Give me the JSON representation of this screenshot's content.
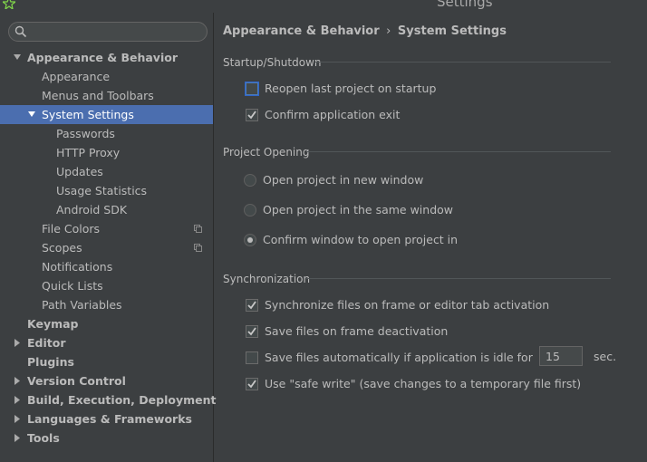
{
  "window": {
    "title": "Settings"
  },
  "search": {
    "placeholder": ""
  },
  "tree": [
    {
      "label": "Appearance & Behavior",
      "level": 0,
      "bold": true,
      "arrow": "down"
    },
    {
      "label": "Appearance",
      "level": 1
    },
    {
      "label": "Menus and Toolbars",
      "level": 1
    },
    {
      "label": "System Settings",
      "level": 1,
      "arrow": "down",
      "selected": true
    },
    {
      "label": "Passwords",
      "level": 2
    },
    {
      "label": "HTTP Proxy",
      "level": 2
    },
    {
      "label": "Updates",
      "level": 2
    },
    {
      "label": "Usage Statistics",
      "level": 2
    },
    {
      "label": "Android SDK",
      "level": 2
    },
    {
      "label": "File Colors",
      "level": 1,
      "copy_icon": true
    },
    {
      "label": "Scopes",
      "level": 1,
      "copy_icon": true
    },
    {
      "label": "Notifications",
      "level": 1
    },
    {
      "label": "Quick Lists",
      "level": 1
    },
    {
      "label": "Path Variables",
      "level": 1
    },
    {
      "label": "Keymap",
      "level": 0,
      "bold": true
    },
    {
      "label": "Editor",
      "level": 0,
      "bold": true,
      "arrow": "right"
    },
    {
      "label": "Plugins",
      "level": 0,
      "bold": true
    },
    {
      "label": "Version Control",
      "level": 0,
      "bold": true,
      "arrow": "right"
    },
    {
      "label": "Build, Execution, Deployment",
      "level": 0,
      "bold": true,
      "arrow": "right"
    },
    {
      "label": "Languages & Frameworks",
      "level": 0,
      "bold": true,
      "arrow": "right"
    },
    {
      "label": "Tools",
      "level": 0,
      "bold": true,
      "arrow": "right"
    }
  ],
  "breadcrumb": {
    "parent": "Appearance & Behavior",
    "separator": "›",
    "current": "System Settings"
  },
  "startup": {
    "title": "Startup/Shutdown",
    "reopen": {
      "label": "Reopen last project on startup",
      "checked": false
    },
    "confirm_exit": {
      "label": "Confirm application exit",
      "checked": true
    }
  },
  "opening": {
    "title": "Project Opening",
    "options": [
      {
        "label": "Open project in new window",
        "selected": false
      },
      {
        "label": "Open project in the same window",
        "selected": false
      },
      {
        "label": "Confirm window to open project in",
        "selected": true
      }
    ]
  },
  "sync": {
    "title": "Synchronization",
    "frame_activation": {
      "label": "Synchronize files on frame or editor tab activation",
      "checked": true
    },
    "frame_deactivation": {
      "label": "Save files on frame deactivation",
      "checked": true
    },
    "auto_save": {
      "label": "Save files automatically if application is idle for",
      "checked": false,
      "value": "15",
      "unit": "sec."
    },
    "safe_write": {
      "label": "Use \"safe write\" (save changes to a temporary file first)",
      "checked": true
    }
  },
  "colors": {
    "selection": "#4b6eaf",
    "background": "#3c3f41",
    "text": "#bbbbbb"
  }
}
